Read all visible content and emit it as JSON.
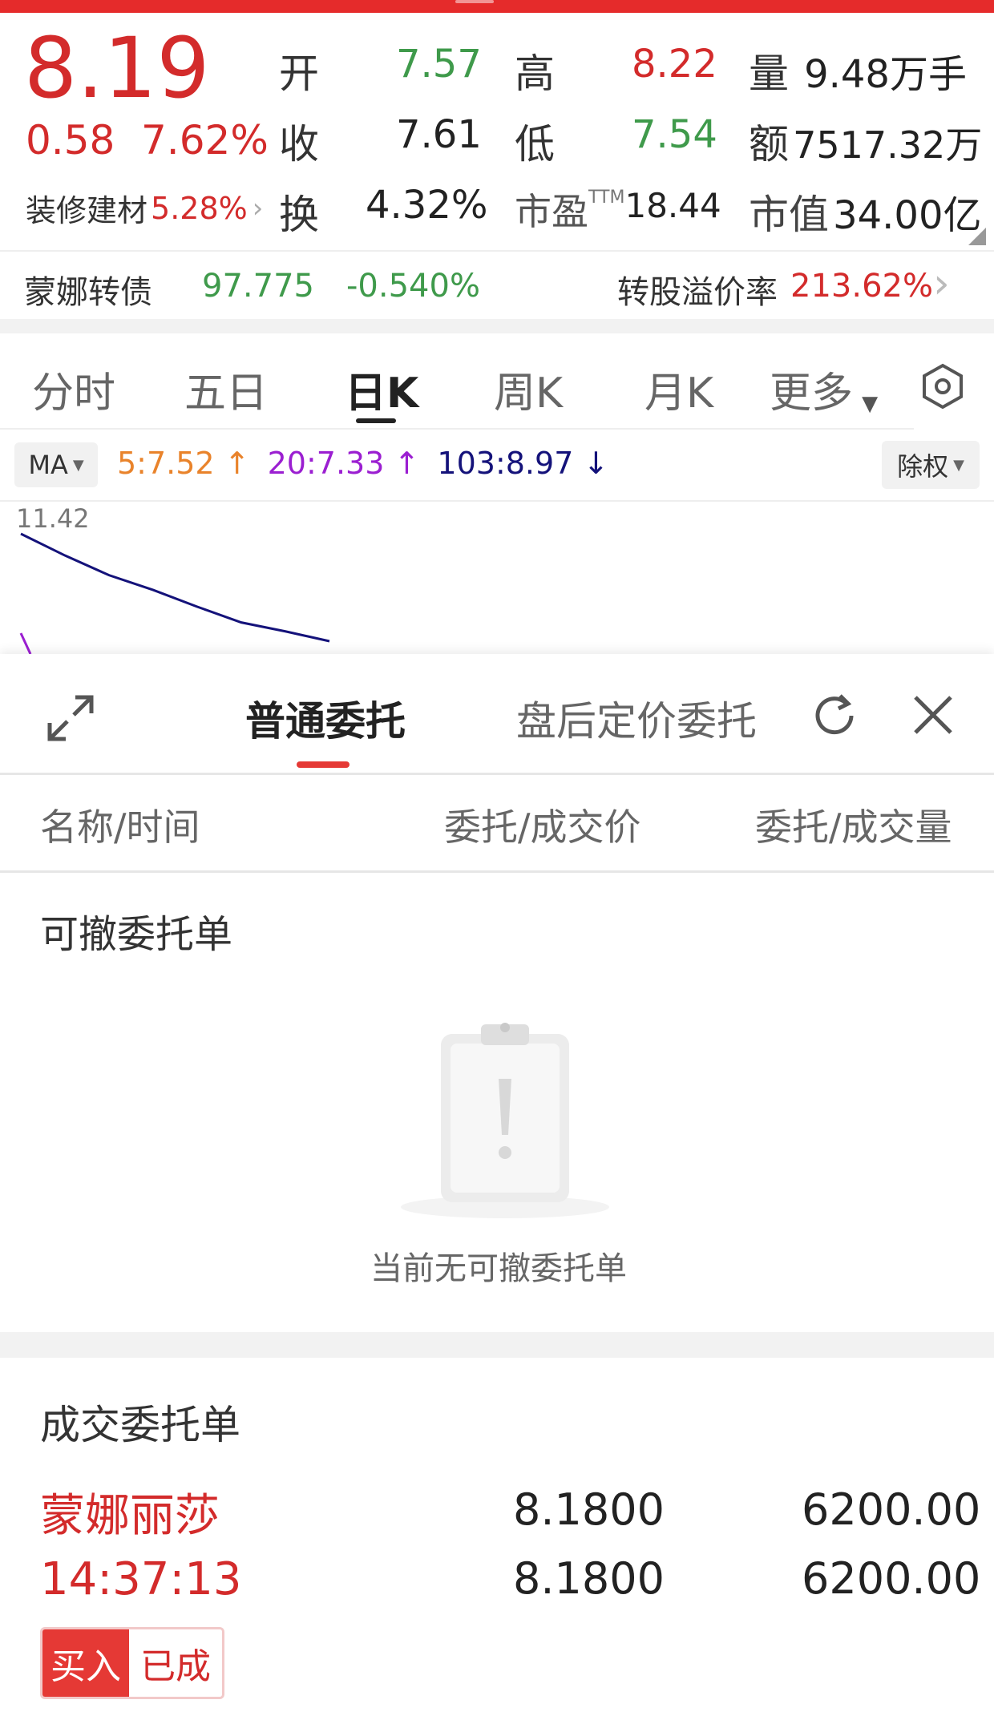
{
  "quote": {
    "price": "8.19",
    "change": "0.58",
    "change_pct": "7.62%",
    "open_label": "开",
    "open_value": "7.57",
    "close_label": "收",
    "close_value": "7.61",
    "turnover_label": "换",
    "turnover_value": "4.32%",
    "high_label": "高",
    "high_value": "8.22",
    "low_label": "低",
    "low_value": "7.54",
    "pe_label": "市盈",
    "pe_sup": "TTM",
    "pe_value": "18.44",
    "volume_label": "量",
    "volume_value": "9.48万手",
    "amount_label": "额",
    "amount_value": "7517.32万",
    "mcap_label": "市值",
    "mcap_value": "34.00亿",
    "sector_name": "装修建材",
    "sector_pct": "5.28%"
  },
  "bond": {
    "name": "蒙娜转债",
    "price": "97.775",
    "pct": "-0.540%",
    "premium_label": "转股溢价率",
    "premium_value": "213.62%"
  },
  "chart_tabs": [
    "分时",
    "五日",
    "日K",
    "周K",
    "月K",
    "更多"
  ],
  "ma_bar": {
    "select_label": "MA",
    "ma5": "5:7.52",
    "ma20": "20:7.33",
    "ma103": "103:8.97",
    "adjust_label": "除权",
    "top_price_label": "11.42",
    "ma5_color": "#e9832b",
    "ma20_color": "#9b1fd1",
    "ma103_color": "#14127a"
  },
  "chart_data": {
    "type": "line",
    "ylim_top": 11.42,
    "series": [
      {
        "values": [
          11.42,
          11.2,
          11.0,
          10.85,
          10.68,
          10.52,
          10.43,
          10.33
        ]
      }
    ]
  },
  "orders_panel": {
    "tab_normal": "普通委托",
    "tab_after_hours": "盘后定价委托",
    "col_name_time": "名称/时间",
    "col_price": "委托/成交价",
    "col_qty": "委托/成交量",
    "cancelable_title": "可撤委托单",
    "empty_text": "当前无可撤委托单",
    "filled_title": "成交委托单",
    "filled_orders": [
      {
        "name": "蒙娜丽莎",
        "time": "14:37:13",
        "order_price": "8.1800",
        "deal_price": "8.1800",
        "order_qty": "6200.00",
        "deal_qty": "6200.00",
        "side": "买入",
        "status": "已成"
      }
    ]
  }
}
